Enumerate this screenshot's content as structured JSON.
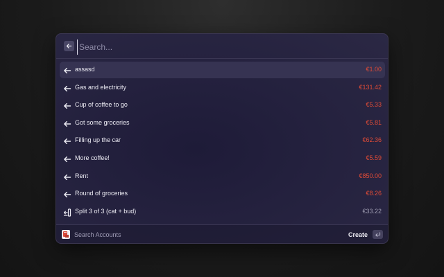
{
  "search": {
    "placeholder": "Search...",
    "value": ""
  },
  "colors": {
    "expense": "#e04b36",
    "neutral": "#9d9bb0"
  },
  "transactions": [
    {
      "label": "assasd",
      "amount": "€1.00",
      "icon": "arrow-left-icon",
      "type": "expense",
      "selected": true
    },
    {
      "label": "Gas and electricity",
      "amount": "€131.42",
      "icon": "arrow-left-icon",
      "type": "expense"
    },
    {
      "label": "Cup of coffee to go",
      "amount": "€5.33",
      "icon": "arrow-left-icon",
      "type": "expense"
    },
    {
      "label": "Got some groceries",
      "amount": "€5.81",
      "icon": "arrow-left-icon",
      "type": "expense"
    },
    {
      "label": "Filling up the car",
      "amount": "€62.36",
      "icon": "arrow-left-icon",
      "type": "expense"
    },
    {
      "label": "More coffee!",
      "amount": "€5.59",
      "icon": "arrow-left-icon",
      "type": "expense"
    },
    {
      "label": "Rent",
      "amount": "€850.00",
      "icon": "arrow-left-icon",
      "type": "expense"
    },
    {
      "label": "Round of groceries",
      "amount": "€8.26",
      "icon": "arrow-left-icon",
      "type": "expense"
    },
    {
      "label": "Split 3 of 3 (cat + bud)",
      "amount": "€33.22",
      "icon": "split-icon",
      "type": "neutral"
    }
  ],
  "footer": {
    "account_label": "Search Accounts",
    "account_icon": "account-icon",
    "create_label": "Create",
    "enter_icon": "enter-key-icon"
  }
}
